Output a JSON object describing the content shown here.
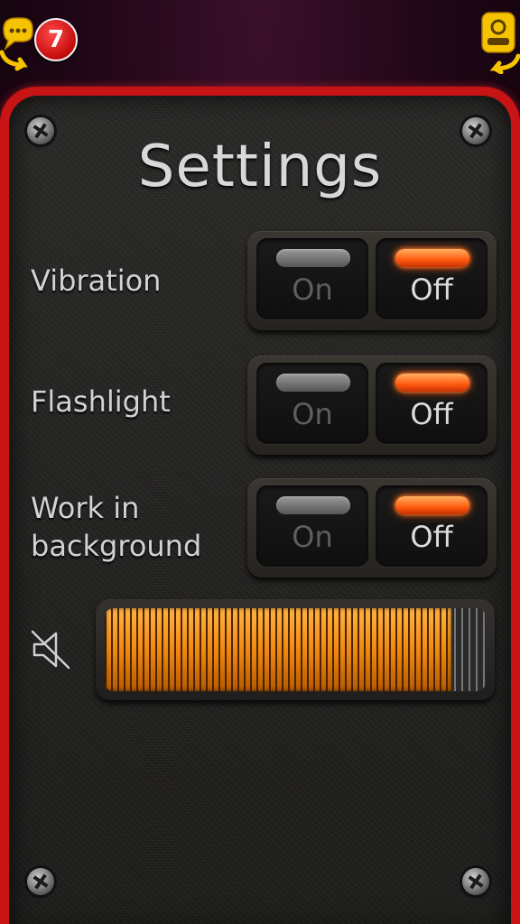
{
  "topbar": {
    "chat_badge_count": "7",
    "icon_color": "#f5c300"
  },
  "title": "Settings",
  "settings": [
    {
      "label_line1": "Vibration",
      "label_line2": "",
      "on_label": "On",
      "off_label": "Off",
      "state": "off"
    },
    {
      "label_line1": "Flashlight",
      "label_line2": "",
      "on_label": "On",
      "off_label": "Off",
      "state": "off"
    },
    {
      "label_line1": "Work in",
      "label_line2": "background",
      "on_label": "On",
      "off_label": "Off",
      "state": "off"
    }
  ],
  "volume": {
    "icon": "speaker-muted-icon",
    "level": 0.91
  },
  "colors": {
    "panel_border": "#c81414",
    "lamp_lit": "#ff5a10",
    "volume_fill": "#f08a10"
  }
}
